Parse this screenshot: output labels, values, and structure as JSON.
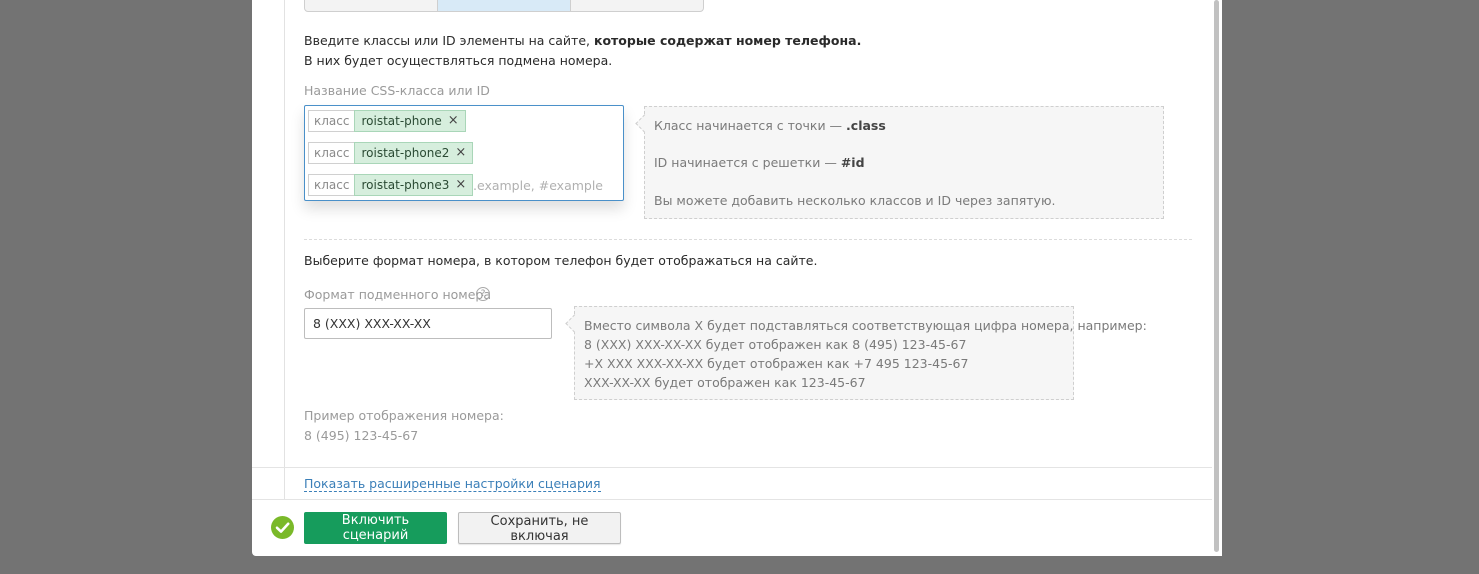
{
  "section_css": {
    "intro_regular": "Введите классы или ID элементы на сайте, ",
    "intro_bold": "которые содержат номер телефона.",
    "intro_line2": "В них будет осуществляться подмена номера.",
    "field_label": "Название CSS-класса или ID",
    "tags": [
      {
        "kind": "класс",
        "value": "roistat-phone"
      },
      {
        "kind": "класс",
        "value": "roistat-phone2"
      },
      {
        "kind": "класс",
        "value": "roistat-phone3"
      }
    ],
    "remove_icon": "×",
    "input_placeholder": ".example, #example",
    "hint": {
      "line1_text": "Класс начинается с точки — ",
      "line1_code": ".class",
      "line2_text": "ID начинается с решетки — ",
      "line2_code": "#id",
      "line3_text": "Вы можете добавить несколько классов и ID через запятую."
    }
  },
  "section_format": {
    "intro": "Выберите формат номера, в котором телефон будет отображаться на сайте.",
    "field_label": "Формат подменного номера",
    "help_icon": "?",
    "value": "8 (XXX) XXX-XX-XX",
    "hint_lines": [
      "Вместо символа X будет подставляться соответствующая цифра номера, например:",
      "8 (XXX) XXX-XX-XX будет отображен как 8 (495) 123-45-67",
      "+X XXX XXX-XX-XX будет отображен как +7 495 123-45-67",
      "XXX-XX-XX будет отображен как 123-45-67"
    ],
    "example_label": "Пример отображения номера:",
    "example_value": "8 (495) 123-45-67"
  },
  "advanced_link": "Показать расширенные настройки сценария",
  "footer": {
    "enable_button": "Включить сценарий",
    "save_button": "Сохранить, не включая"
  },
  "colors": {
    "primary": "#169c5c",
    "success_icon": "#7ab929",
    "link": "#3b7fb8",
    "tag_bg": "#d6eedd"
  }
}
